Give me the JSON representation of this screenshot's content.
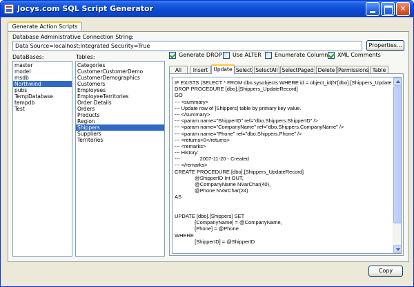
{
  "window": {
    "title": "Jocys.com SQL Script Generator"
  },
  "main_tab": {
    "label": "Generate Action Scripts"
  },
  "connection": {
    "label": "Database Administrative Connection String:",
    "value": "Data Source=localhost;Integrated Security=True",
    "properties_button": "Properties..."
  },
  "databases": {
    "label": "DataBases:",
    "items": [
      "master",
      "model",
      "msdb",
      "Northwind",
      "pubs",
      "TempDatabase",
      "tempdb",
      "Test"
    ],
    "selected": "Northwind"
  },
  "tables": {
    "label": "Tables:",
    "items": [
      "Categories",
      "CustomerCustomerDemo",
      "CustomerDemographics",
      "Customers",
      "Employees",
      "EmployeeTerritories",
      "Order Details",
      "Orders",
      "Products",
      "Region",
      "Shippers",
      "Suppliers",
      "Territories"
    ],
    "selected": "Shippers"
  },
  "options": {
    "generate_drop": {
      "label": "Generate DROP",
      "checked": true
    },
    "use_alter": {
      "label": "Use ALTER",
      "checked": false
    },
    "enumerate_columns": {
      "label": "Enumerate Columns",
      "checked": false
    },
    "xml_comments": {
      "label": "XML Comments",
      "checked": true
    }
  },
  "script_tabs": {
    "items": [
      "All",
      "Insert",
      "Update",
      "Select",
      "SelectAll",
      "SelectPaged",
      "Delete",
      "Permissions",
      "Table"
    ],
    "active": "Update"
  },
  "script": {
    "lines": [
      "IF EXISTS (SELECT * FROM dbo.sysobjects WHERE id = object_id(N'[dbo].[Shippers_Update",
      "DROP PROCEDURE [dbo].[Shippers_UpdateRecord]",
      "GO",
      "--- <summary>",
      "--- Update row of [Shippers] table by primary key value.",
      "--- </summary>",
      "--- <param name=\"ShipperID\" ref=\"dbo.Shippers.ShipperID\" />",
      "--- <param name=\"CompanyName\" ref=\"dbo.Shippers.CompanyName\" />",
      "--- <param name=\"Phone\" ref=\"dbo.Shippers.Phone\" />",
      "--- <returns>0</returns>",
      "--- <remarks>",
      "--- History:",
      "---              2007-11-20 - Created",
      "--- </remarks>",
      "CREATE PROCEDURE [dbo].[Shippers_UpdateRecord]",
      "              @ShipperID Int OUT,",
      "              @CompanyName NVarChar(40),",
      "              @Phone NVarChar(24)",
      "AS",
      "",
      "",
      "UPDATE [dbo].[Shippers] SET",
      "              [CompanyName] = @CompanyName,",
      "              [Phone] = @Phone",
      "WHERE",
      "              [ShipperID] = @ShipperID"
    ]
  },
  "footer": {
    "copy_button": "Copy"
  },
  "colors": {
    "titlebar": "#0a4bd4",
    "selection": "#316ac5",
    "tab_highlight": "#ffc83c"
  }
}
